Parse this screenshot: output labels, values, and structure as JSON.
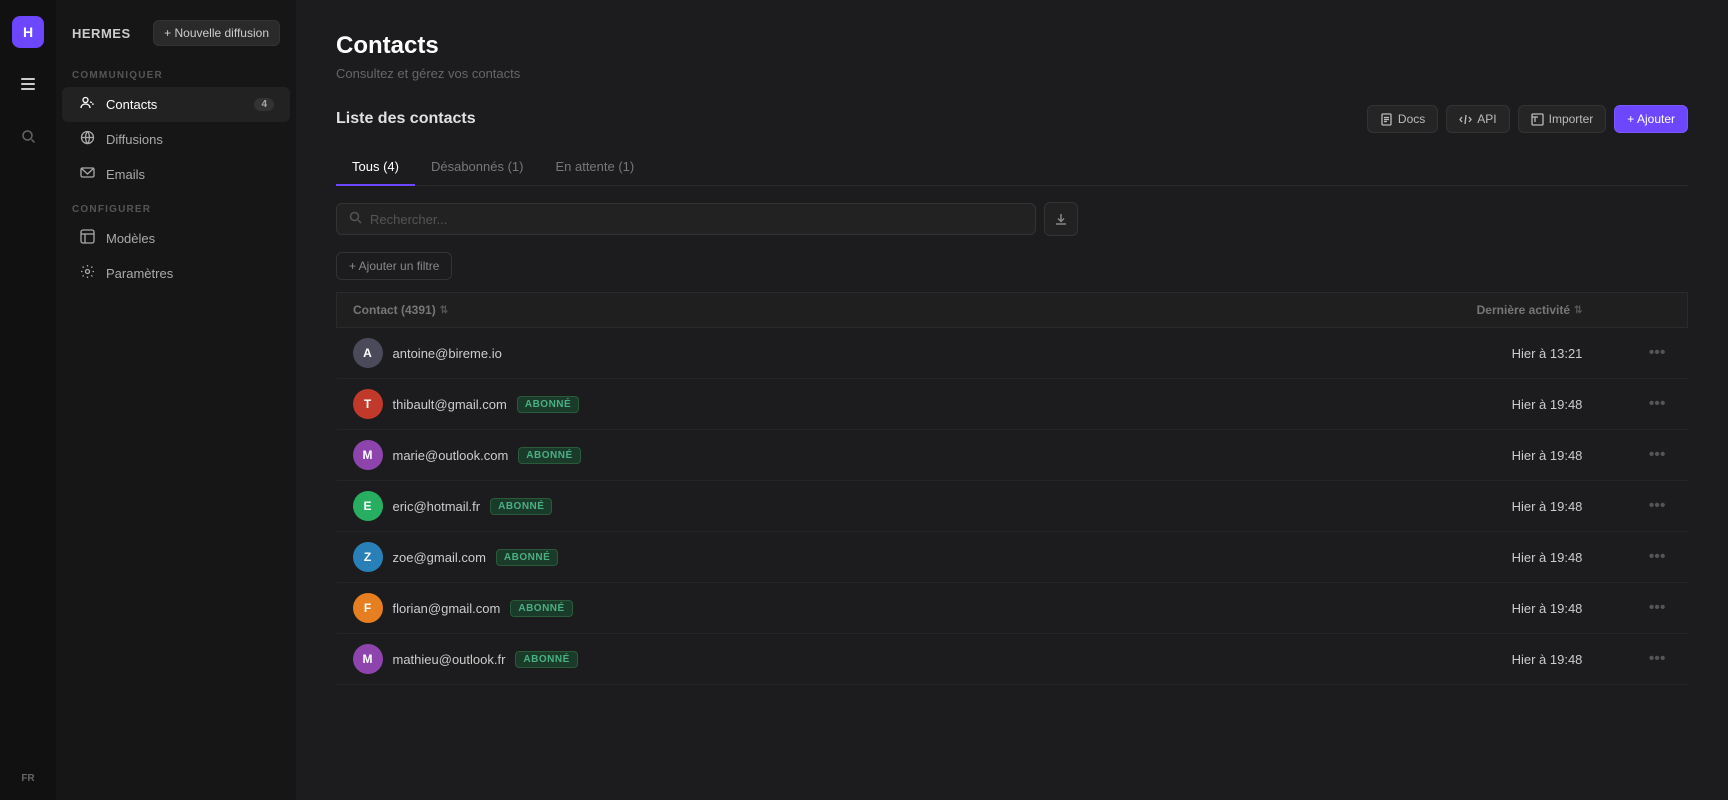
{
  "app": {
    "logo_letter": "H",
    "name": "HERMES",
    "new_broadcast_label": "+ Nouvelle diffusion"
  },
  "sidebar": {
    "communiquer_label": "COMMUNIQUER",
    "configurer_label": "CONFIGURER",
    "items_communiquer": [
      {
        "id": "contacts",
        "label": "Contacts",
        "icon": "👥",
        "badge": "4",
        "active": true
      },
      {
        "id": "diffusions",
        "label": "Diffusions",
        "icon": "🌐",
        "badge": null,
        "active": false
      },
      {
        "id": "emails",
        "label": "Emails",
        "icon": "✉️",
        "badge": null,
        "active": false
      }
    ],
    "items_configurer": [
      {
        "id": "modeles",
        "label": "Modèles",
        "icon": "🎨",
        "badge": null,
        "active": false
      },
      {
        "id": "parametres",
        "label": "Paramètres",
        "icon": "⚙️",
        "badge": null,
        "active": false
      }
    ]
  },
  "page": {
    "title": "Contacts",
    "subtitle": "Consultez et gérez vos contacts",
    "list_title": "Liste des contacts"
  },
  "toolbar": {
    "docs_label": "Docs",
    "api_label": "API",
    "importer_label": "Importer",
    "ajouter_label": "+ Ajouter"
  },
  "tabs": [
    {
      "id": "tous",
      "label": "Tous (4)",
      "active": true
    },
    {
      "id": "desabonnes",
      "label": "Désabonnés (1)",
      "active": false
    },
    {
      "id": "en_attente",
      "label": "En attente (1)",
      "active": false
    }
  ],
  "search": {
    "placeholder": "Rechercher..."
  },
  "filter_btn": "+ Ajouter un filtre",
  "table": {
    "col_contact": "Contact (4391)",
    "col_activity": "Dernière activité",
    "contacts": [
      {
        "email": "antoine@bireme.io",
        "avatar_letter": "A",
        "avatar_color": "#4a4a5a",
        "badge": null,
        "activity": "Hier à 13:21"
      },
      {
        "email": "thibault@gmail.com",
        "avatar_letter": "T",
        "avatar_color": "#c0392b",
        "badge": "ABONNÉ",
        "activity": "Hier à 19:48"
      },
      {
        "email": "marie@outlook.com",
        "avatar_letter": "M",
        "avatar_color": "#8e44ad",
        "badge": "ABONNÉ",
        "activity": "Hier à 19:48"
      },
      {
        "email": "eric@hotmail.fr",
        "avatar_letter": "E",
        "avatar_color": "#27ae60",
        "badge": "ABONNÉ",
        "activity": "Hier à 19:48"
      },
      {
        "email": "zoe@gmail.com",
        "avatar_letter": "Z",
        "avatar_color": "#2980b9",
        "badge": "ABONNÉ",
        "activity": "Hier à 19:48"
      },
      {
        "email": "florian@gmail.com",
        "avatar_letter": "F",
        "avatar_color": "#e67e22",
        "badge": "ABONNÉ",
        "activity": "Hier à 19:48"
      },
      {
        "email": "mathieu@outlook.fr",
        "avatar_letter": "M",
        "avatar_color": "#8e44ad",
        "badge": "ABONNÉ",
        "activity": "Hier à 19:48"
      }
    ]
  },
  "lang": "FR"
}
